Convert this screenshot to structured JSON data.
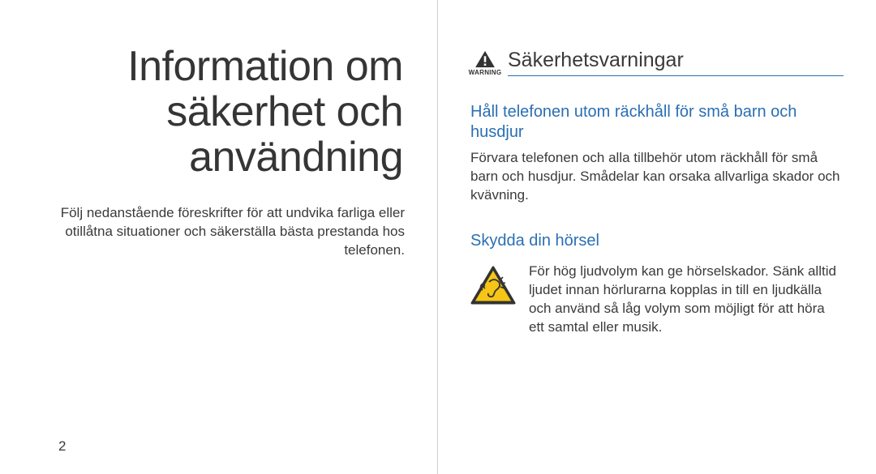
{
  "left": {
    "title_line1": "Information om",
    "title_line2": "säkerhet och",
    "title_line3": "användning",
    "intro": "Följ nedanstående föreskrifter för att undvika farliga eller otillåtna situationer och säkerställa bästa prestanda hos telefonen.",
    "page_number": "2"
  },
  "right": {
    "warning_label": "WARNING",
    "section_title": "Säkerhetsvarningar",
    "heading1": "Håll telefonen utom räckhåll för små barn och husdjur",
    "body1": "Förvara telefonen och alla tillbehör utom räckhåll för små barn och husdjur. Smådelar kan orsaka allvarliga skador och kvävning.",
    "heading2": "Skydda din hörsel",
    "body2": "För hög ljudvolym kan ge hörselskador. Sänk alltid ljudet innan hörlurarna kopplas in till en ljudkälla och använd så låg volym som möjligt för att höra ett samtal eller musik."
  },
  "icons": {
    "warning": "warning-triangle-icon",
    "hearing": "hearing-damage-icon"
  }
}
